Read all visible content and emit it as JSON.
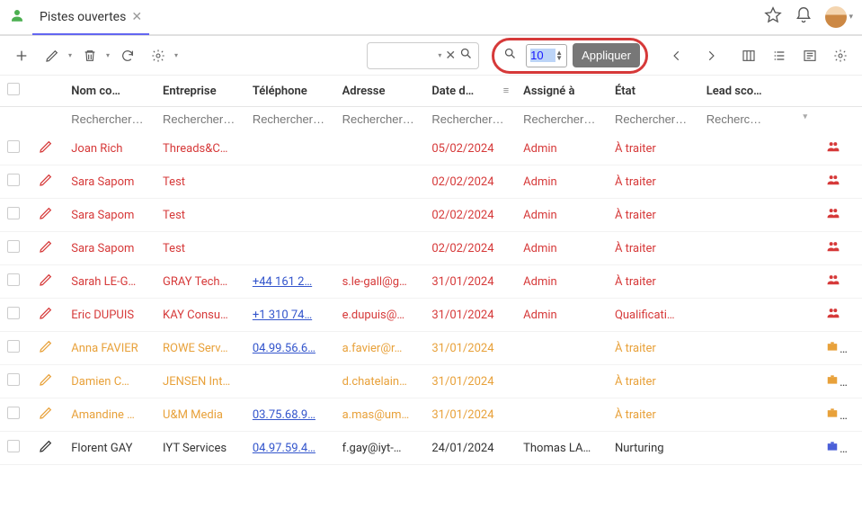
{
  "header": {
    "tab_title": "Pistes ouvertes"
  },
  "toolbar": {
    "page_input": "10",
    "apply_label": "Appliquer"
  },
  "columns": {
    "name": "Nom co…",
    "company": "Entreprise",
    "phone": "Téléphone",
    "address": "Adresse",
    "date": "Date d…",
    "assigned": "Assigné à",
    "status": "État",
    "score": "Lead sco…"
  },
  "search_placeholders": {
    "name": "Rechercher…",
    "company": "Rechercher…",
    "phone": "Rechercher…",
    "address": "Rechercher…",
    "date": "Rechercher…",
    "assigned": "Rechercher…",
    "status": "Rechercher…",
    "score": "Recherc…"
  },
  "rows": [
    {
      "color": "red",
      "name": "Joan Rich",
      "company": "Threads&C…",
      "phone": "",
      "address": "",
      "date": "05/02/2024",
      "assigned": "Admin",
      "status": "À traiter",
      "briefcase": false,
      "people": "red"
    },
    {
      "color": "red",
      "name": "Sara Sapom",
      "company": "Test",
      "phone": "",
      "address": "",
      "date": "02/02/2024",
      "assigned": "Admin",
      "status": "À traiter",
      "briefcase": false,
      "people": "red"
    },
    {
      "color": "red",
      "name": "Sara Sapom",
      "company": "Test",
      "phone": "",
      "address": "",
      "date": "02/02/2024",
      "assigned": "Admin",
      "status": "À traiter",
      "briefcase": false,
      "people": "red"
    },
    {
      "color": "red",
      "name": "Sara Sapom",
      "company": "Test",
      "phone": "",
      "address": "",
      "date": "02/02/2024",
      "assigned": "Admin",
      "status": "À traiter",
      "briefcase": false,
      "people": "red"
    },
    {
      "color": "red",
      "name": "Sarah LE-G…",
      "company": "GRAY Tech…",
      "phone": "+44 161 2…",
      "address": "s.le-gall@g…",
      "date": "31/01/2024",
      "assigned": "Admin",
      "status": "À traiter",
      "briefcase": false,
      "people": "red",
      "phone_link": true
    },
    {
      "color": "red",
      "name": "Eric DUPUIS",
      "company": "KAY Consu…",
      "phone": "+1 310 74…",
      "address": "e.dupuis@…",
      "date": "31/01/2024",
      "assigned": "Admin",
      "status": "Qualificati…",
      "briefcase": false,
      "people": "red",
      "phone_link": true
    },
    {
      "color": "orange",
      "name": "Anna FAVIER",
      "company": "ROWE Serv…",
      "phone": "04.99.56.6…",
      "address": "a.favier@r…",
      "date": "31/01/2024",
      "assigned": "",
      "status": "À traiter",
      "briefcase": true,
      "people": "orange",
      "phone_link": true
    },
    {
      "color": "orange",
      "name": "Damien C…",
      "company": "JENSEN Int…",
      "phone": "",
      "address": "d.chatelain…",
      "date": "31/01/2024",
      "assigned": "",
      "status": "À traiter",
      "briefcase": true,
      "people": "orange"
    },
    {
      "color": "orange",
      "name": "Amandine …",
      "company": "U&M Media",
      "phone": "03.75.68.9…",
      "address": "a.mas@um…",
      "date": "31/01/2024",
      "assigned": "",
      "status": "À traiter",
      "briefcase": true,
      "people": "orange",
      "phone_link": true
    },
    {
      "color": "dark",
      "name": "Florent GAY",
      "company": "IYT Services",
      "phone": "04.97.59.4…",
      "address": "f.gay@iyt-…",
      "date": "24/01/2024",
      "assigned": "Thomas LA…",
      "status": "Nurturing",
      "briefcase": true,
      "briefcase_color": "blue",
      "people": "blue",
      "phone_link": true
    }
  ]
}
